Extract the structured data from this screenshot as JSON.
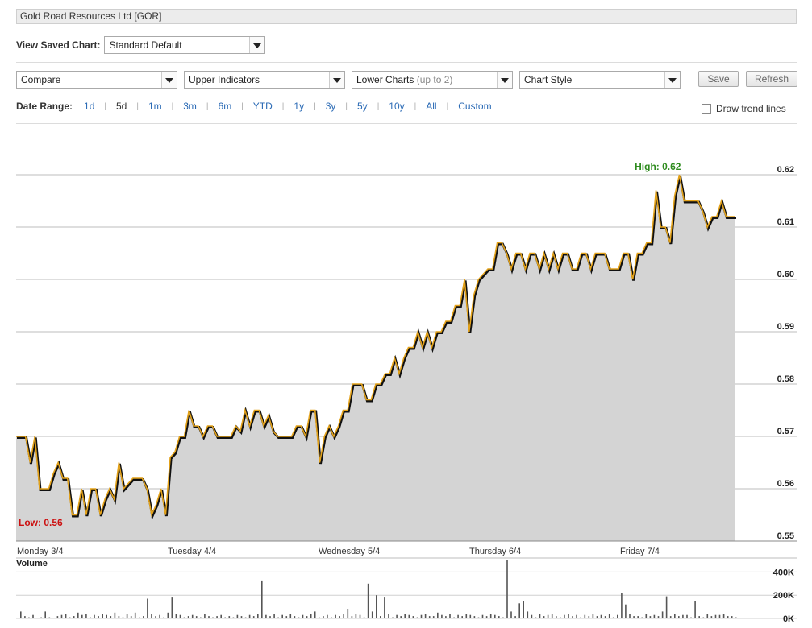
{
  "title": "Gold Road Resources Ltd [GOR]",
  "saved_chart": {
    "label": "View Saved Chart:",
    "value": "Standard Default"
  },
  "dropdowns": {
    "compare": "Compare",
    "upper": "Upper Indicators",
    "lower": "Lower Charts",
    "lower_hint": "(up to 2)",
    "style": "Chart Style"
  },
  "buttons": {
    "save": "Save",
    "refresh": "Refresh"
  },
  "date_range": {
    "label": "Date Range:",
    "options": [
      "1d",
      "5d",
      "1m",
      "3m",
      "6m",
      "YTD",
      "1y",
      "3y",
      "5y",
      "10y",
      "All",
      "Custom"
    ],
    "active": "5d"
  },
  "trend_lines_label": "Draw trend lines",
  "colors": {
    "line": "#e3a21a",
    "line_shadow": "#111111",
    "area": "#d4d4d4",
    "high": "#2e8b1e",
    "low": "#cc1111",
    "volume": "#555555"
  },
  "chart_data": {
    "type": "area",
    "ylim": [
      0.55,
      0.62
    ],
    "yticks": [
      "0.62",
      "0.61",
      "0.60",
      "0.59",
      "0.58",
      "0.57",
      "0.56",
      "0.55"
    ],
    "day_labels": [
      "Monday 3/4",
      "Tuesday 4/4",
      "Wednesday 5/4",
      "Thursday 6/4",
      "Friday 7/4"
    ],
    "high_label": "High: 0.62",
    "low_label": "Low: 0.56",
    "price": [
      0.57,
      0.57,
      0.57,
      0.565,
      0.57,
      0.56,
      0.56,
      0.56,
      0.563,
      0.565,
      0.562,
      0.562,
      0.555,
      0.555,
      0.56,
      0.555,
      0.56,
      0.56,
      0.555,
      0.558,
      0.56,
      0.558,
      0.565,
      0.56,
      0.561,
      0.562,
      0.562,
      0.562,
      0.56,
      0.555,
      0.557,
      0.56,
      0.555,
      0.566,
      0.567,
      0.57,
      0.57,
      0.575,
      0.572,
      0.572,
      0.57,
      0.572,
      0.572,
      0.57,
      0.57,
      0.57,
      0.57,
      0.572,
      0.571,
      0.575,
      0.572,
      0.575,
      0.575,
      0.572,
      0.574,
      0.571,
      0.57,
      0.57,
      0.57,
      0.57,
      0.572,
      0.572,
      0.57,
      0.575,
      0.575,
      0.565,
      0.57,
      0.572,
      0.57,
      0.572,
      0.575,
      0.575,
      0.58,
      0.58,
      0.58,
      0.577,
      0.577,
      0.58,
      0.58,
      0.582,
      0.582,
      0.585,
      0.582,
      0.585,
      0.587,
      0.587,
      0.59,
      0.587,
      0.59,
      0.587,
      0.59,
      0.59,
      0.592,
      0.592,
      0.595,
      0.595,
      0.6,
      0.59,
      0.597,
      0.6,
      0.601,
      0.602,
      0.602,
      0.607,
      0.607,
      0.605,
      0.602,
      0.605,
      0.605,
      0.602,
      0.605,
      0.605,
      0.602,
      0.605,
      0.602,
      0.605,
      0.602,
      0.605,
      0.605,
      0.602,
      0.602,
      0.605,
      0.605,
      0.602,
      0.605,
      0.605,
      0.605,
      0.602,
      0.602,
      0.602,
      0.605,
      0.605,
      0.6,
      0.605,
      0.605,
      0.607,
      0.607,
      0.617,
      0.61,
      0.61,
      0.607,
      0.616,
      0.62,
      0.615,
      0.615,
      0.615,
      0.615,
      0.613,
      0.61,
      0.612,
      0.612,
      0.615,
      0.612,
      0.612,
      0.612
    ],
    "volume_label": "Volume",
    "volume_ticks": [
      "400K",
      "200K",
      "0K"
    ],
    "volume_max": 500000,
    "volume": [
      60000,
      20000,
      10000,
      30000,
      5000,
      10000,
      60000,
      10000,
      5000,
      20000,
      30000,
      40000,
      10000,
      20000,
      50000,
      30000,
      40000,
      10000,
      30000,
      20000,
      40000,
      30000,
      20000,
      50000,
      20000,
      10000,
      40000,
      20000,
      50000,
      10000,
      20000,
      170000,
      40000,
      20000,
      30000,
      10000,
      50000,
      180000,
      40000,
      30000,
      10000,
      20000,
      30000,
      20000,
      10000,
      40000,
      20000,
      10000,
      20000,
      30000,
      10000,
      20000,
      10000,
      30000,
      20000,
      10000,
      30000,
      20000,
      40000,
      320000,
      30000,
      20000,
      40000,
      10000,
      30000,
      20000,
      40000,
      20000,
      10000,
      30000,
      20000,
      40000,
      60000,
      10000,
      20000,
      30000,
      10000,
      30000,
      20000,
      40000,
      80000,
      20000,
      40000,
      30000,
      10000,
      300000,
      60000,
      200000,
      20000,
      180000,
      40000,
      10000,
      30000,
      20000,
      40000,
      30000,
      20000,
      10000,
      30000,
      40000,
      20000,
      20000,
      50000,
      30000,
      20000,
      40000,
      10000,
      30000,
      20000,
      40000,
      30000,
      20000,
      10000,
      30000,
      20000,
      40000,
      30000,
      20000,
      10000,
      500000,
      60000,
      20000,
      130000,
      150000,
      60000,
      30000,
      10000,
      40000,
      20000,
      30000,
      40000,
      20000,
      10000,
      30000,
      40000,
      20000,
      30000,
      10000,
      30000,
      20000,
      40000,
      20000,
      30000,
      20000,
      40000,
      10000,
      30000,
      220000,
      120000,
      40000,
      20000,
      20000,
      10000,
      40000,
      20000,
      30000,
      20000,
      60000,
      190000,
      20000,
      40000,
      20000,
      30000,
      30000,
      10000,
      150000,
      20000,
      10000,
      40000,
      20000,
      30000,
      30000,
      40000,
      20000,
      20000,
      10000
    ]
  }
}
